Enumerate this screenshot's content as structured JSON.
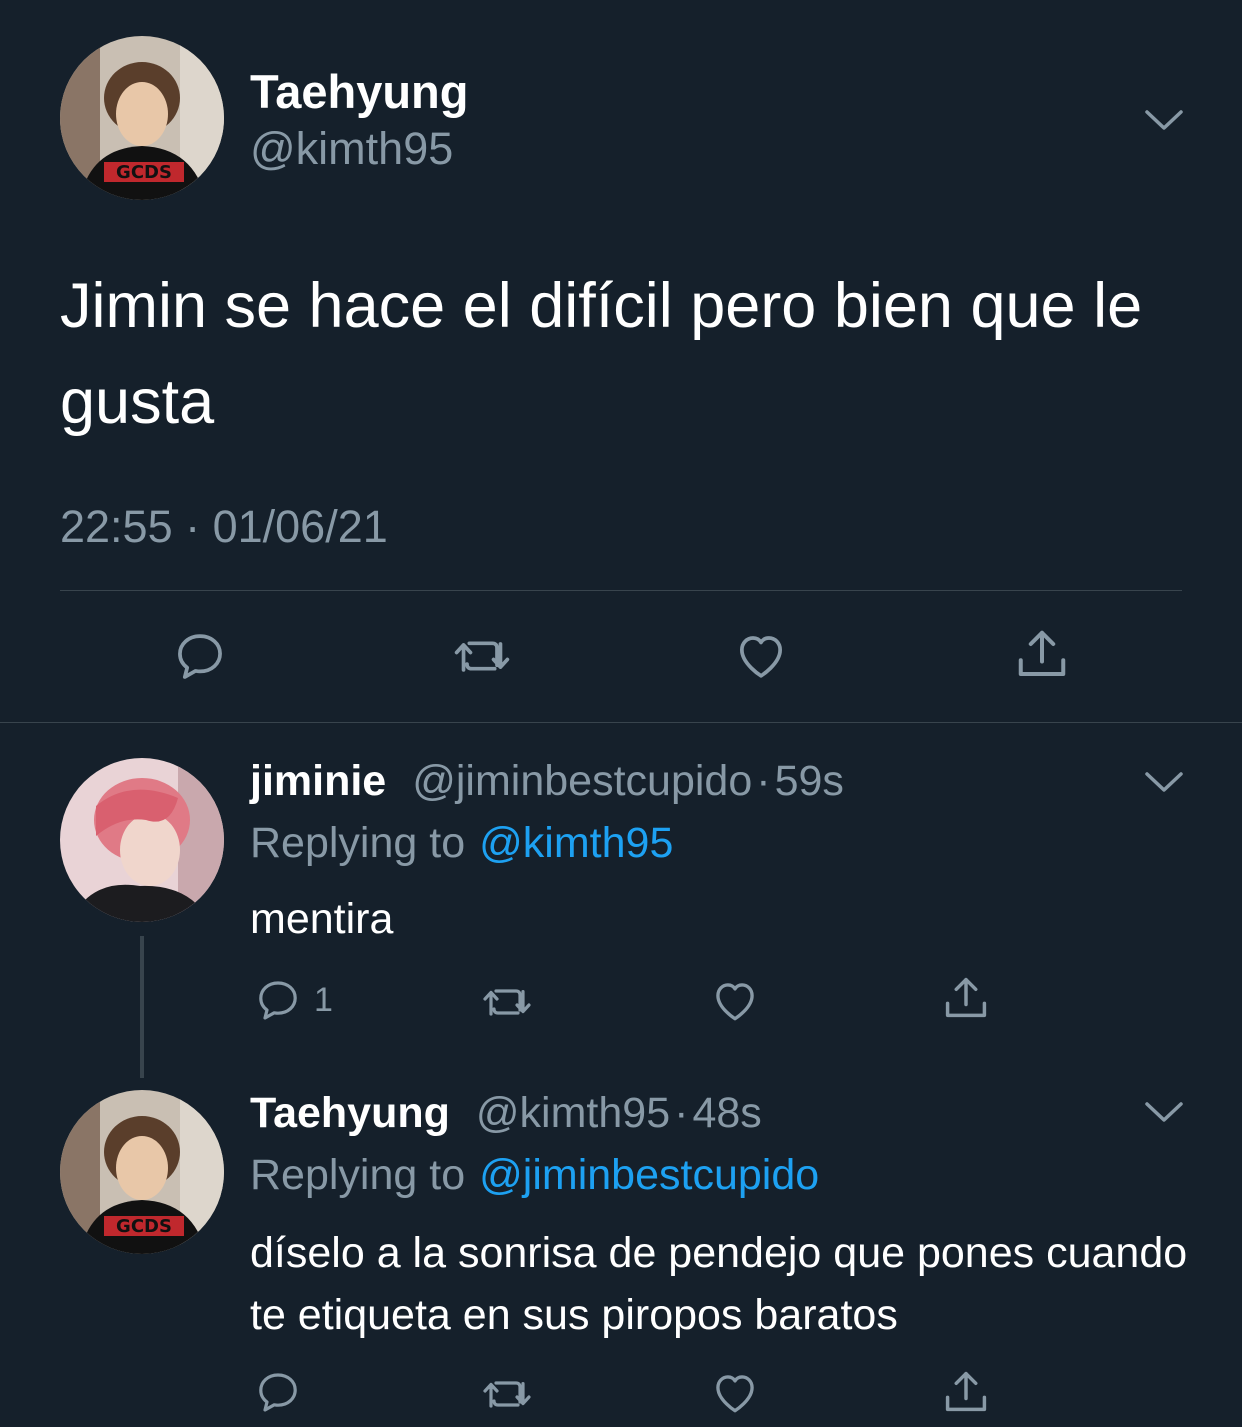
{
  "main_tweet": {
    "name": "Taehyung",
    "handle": "@kimth95",
    "text": "Jimin se hace el difícil pero bien que le gusta",
    "timestamp": "22:55 · 01/06/21",
    "avatar_icon": "avatar-taehyung"
  },
  "replies": [
    {
      "name": "jiminie",
      "handle": "@jiminbestcupido",
      "dot": "·",
      "time": "59s",
      "replying_prefix": "Replying to",
      "replying_to": "@kimth95",
      "text": "mentira",
      "reply_count": "1",
      "avatar_icon": "avatar-jiminie"
    },
    {
      "name": "Taehyung",
      "handle": "@kimth95",
      "dot": "·",
      "time": "48s",
      "replying_prefix": "Replying to",
      "replying_to": "@jiminbestcupido",
      "text": "díselo a la sonrisa de pendejo que pones cuando te etiqueta en sus piropos baratos",
      "reply_count": "",
      "avatar_icon": "avatar-taehyung"
    }
  ],
  "colors": {
    "background": "#15202b",
    "secondary_text": "#8899a6",
    "mention": "#1da1f2",
    "divider": "#38444d"
  },
  "icons": {
    "reply": "reply-icon",
    "retweet": "retweet-icon",
    "like": "heart-icon",
    "share": "share-icon",
    "more": "chevron-down-icon"
  }
}
